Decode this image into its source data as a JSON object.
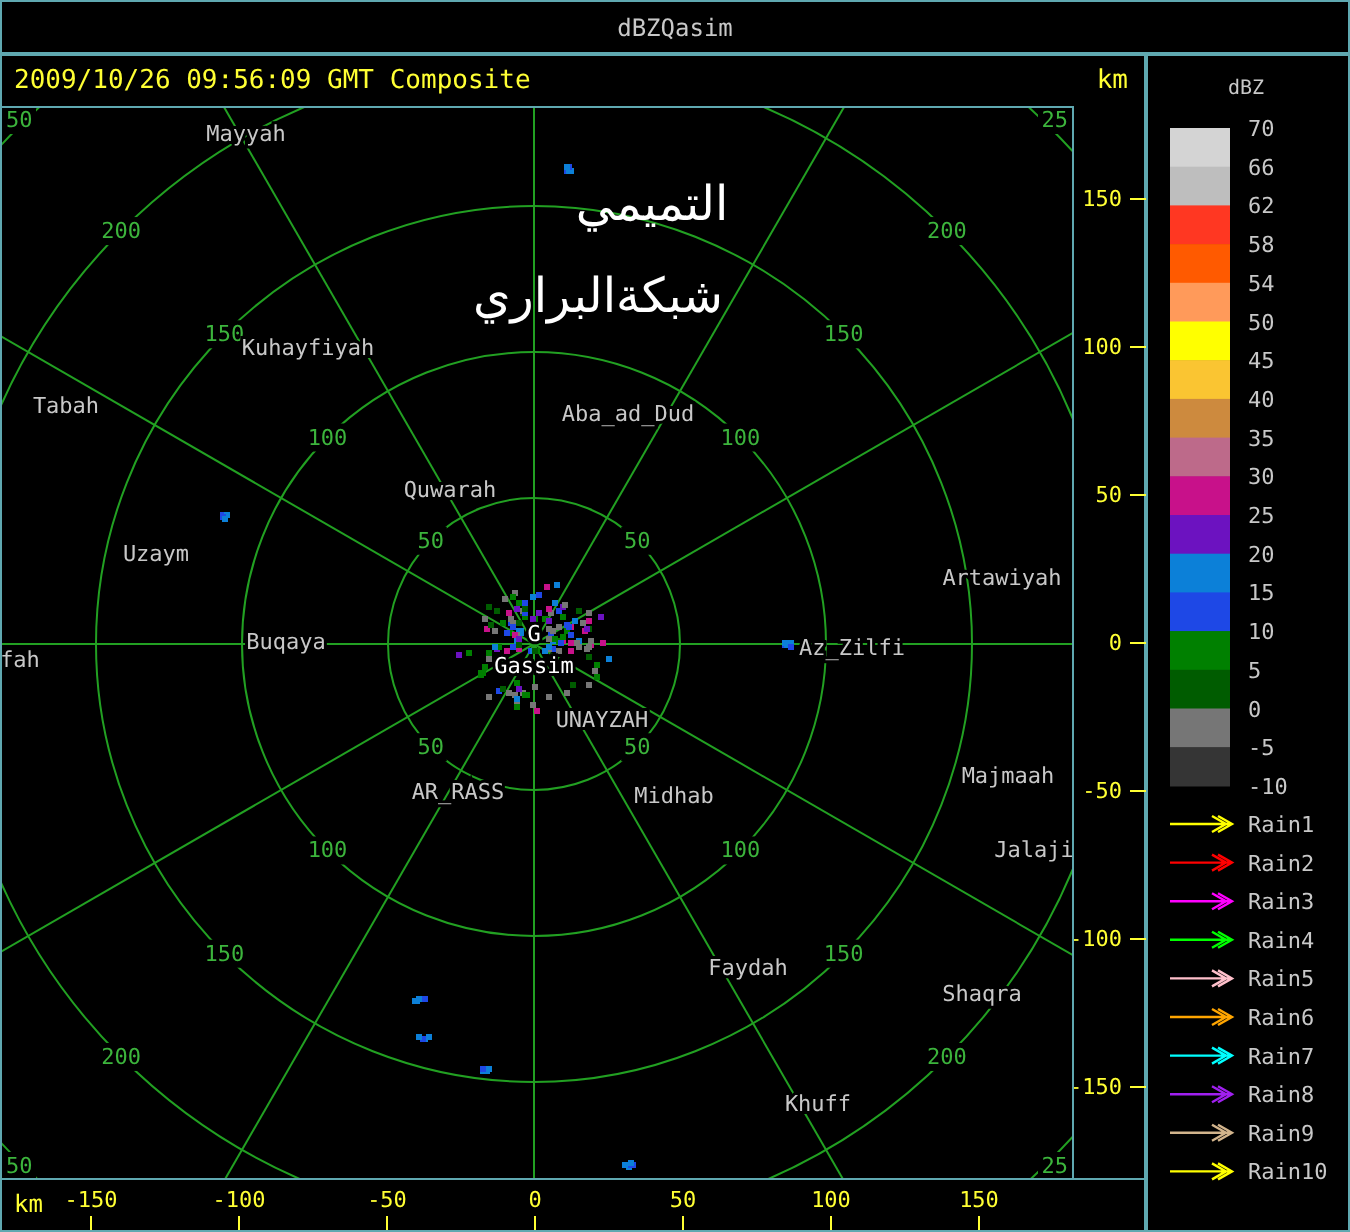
{
  "window": {
    "title": "dBZQasim"
  },
  "header": {
    "timestamp": "2009/10/26 09:56:09 GMT Composite",
    "unit": "km"
  },
  "plot": {
    "overlay_text": [
      "التميمي",
      "شبكةالبراري"
    ],
    "rings": [
      {
        "labels": [
          "50",
          "50",
          "50",
          "50"
        ]
      },
      {
        "labels": [
          "100",
          "100",
          "100",
          "100"
        ]
      },
      {
        "labels": [
          "150",
          "150",
          "150",
          "150"
        ]
      },
      {
        "labels": [
          "200",
          "200",
          "200",
          "200"
        ]
      },
      {
        "labels": [
          "50",
          "25",
          "50",
          "25"
        ]
      }
    ],
    "places": [
      {
        "name": "Mayyah",
        "kind": "town"
      },
      {
        "name": "Kuhayfiyah",
        "kind": "town"
      },
      {
        "name": "Tabah",
        "kind": "town"
      },
      {
        "name": "Aba_ad_Dud",
        "kind": "town"
      },
      {
        "name": "Quwarah",
        "kind": "town"
      },
      {
        "name": "Uzaym",
        "kind": "town"
      },
      {
        "name": "Artawiyah",
        "kind": "town"
      },
      {
        "name": "fah",
        "kind": "town"
      },
      {
        "name": "Buqaya",
        "kind": "town"
      },
      {
        "name": "G",
        "kind": "radar"
      },
      {
        "name": "Gassim",
        "kind": "radar"
      },
      {
        "name": "Az_Zilfi",
        "kind": "town"
      },
      {
        "name": "UNAYZAH",
        "kind": "town"
      },
      {
        "name": "AR_RASS",
        "kind": "town"
      },
      {
        "name": "Midhab",
        "kind": "town"
      },
      {
        "name": "Majmaah",
        "kind": "town"
      },
      {
        "name": "Jalaji",
        "kind": "town"
      },
      {
        "name": "Faydah",
        "kind": "town"
      },
      {
        "name": "Shaqra",
        "kind": "town"
      },
      {
        "name": "Khuff",
        "kind": "town"
      }
    ]
  },
  "y_axis": {
    "ticks": [
      "150",
      "100",
      "50",
      "0",
      "-50",
      "-100",
      "-150"
    ]
  },
  "x_axis": {
    "unit": "km",
    "ticks": [
      "-150",
      "-100",
      "-50",
      "0",
      "50",
      "100",
      "150"
    ]
  },
  "legend": {
    "title": "dBZ",
    "scale_labels": [
      "70",
      "66",
      "62",
      "58",
      "54",
      "50",
      "45",
      "40",
      "35",
      "30",
      "25",
      "20",
      "15",
      "10",
      "5",
      "0",
      "-5",
      "-10"
    ],
    "swatches": [
      {
        "color": "#d4d4d4"
      },
      {
        "color": "#bebebe"
      },
      {
        "color": "#ff3722"
      },
      {
        "color": "#ff5a00"
      },
      {
        "color": "#ff9a5a"
      },
      {
        "color": "#ffff00"
      },
      {
        "color": "#fac532"
      },
      {
        "color": "#cd8a3e"
      },
      {
        "color": "#bd6a8a"
      },
      {
        "color": "#c8118a"
      },
      {
        "color": "#6c12c0"
      },
      {
        "color": "#0c80d8"
      },
      {
        "color": "#1e48e6"
      },
      {
        "color": "#008000"
      },
      {
        "color": "#005c00"
      },
      {
        "color": "#767676"
      },
      {
        "color": "#353535"
      }
    ]
  },
  "tracks": [
    {
      "label": "Rain1",
      "color": "#ffff00"
    },
    {
      "label": "Rain2",
      "color": "#ff0000"
    },
    {
      "label": "Rain3",
      "color": "#ff00ff"
    },
    {
      "label": "Rain4",
      "color": "#00ff00"
    },
    {
      "label": "Rain5",
      "color": "#ffc0cb"
    },
    {
      "label": "Rain6",
      "color": "#ffa500"
    },
    {
      "label": "Rain7",
      "color": "#00ffff"
    },
    {
      "label": "Rain8",
      "color": "#a020f0"
    },
    {
      "label": "Rain9",
      "color": "#d2b48c"
    },
    {
      "label": "Rain10",
      "color": "#ffff00"
    }
  ]
}
